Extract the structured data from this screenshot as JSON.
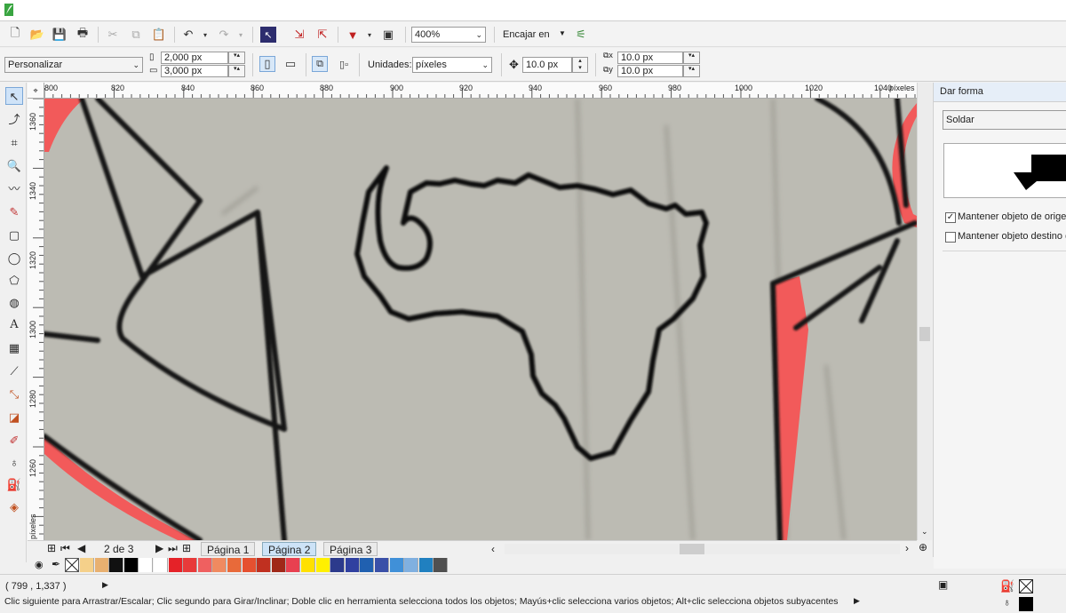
{
  "toolbar1": {
    "zoom_value": "400%",
    "snap_label": "Encajar en"
  },
  "toolbar2": {
    "preset_value": "Personalizar",
    "width_value": "2,000 px",
    "height_value": "3,000 px",
    "units_label": "Unidades:",
    "units_value": "píxeles",
    "nudge_value": "10.0 px",
    "dup_x_value": "10.0 px",
    "dup_y_value": "10.0 px"
  },
  "ruler": {
    "h_ticks": [
      "800",
      "820",
      "840",
      "860",
      "880",
      "900",
      "920",
      "940",
      "960",
      "980",
      "1000",
      "1020",
      "1040"
    ],
    "h_unit": "píxeles",
    "v_ticks": [
      "1360",
      "1340",
      "1320",
      "1300",
      "1280",
      "1260"
    ],
    "v_unit": "píxeles"
  },
  "docker": {
    "title": "Dar forma",
    "mode_value": "Soldar",
    "keep_source_label": "Mantener objeto de origen",
    "keep_source_checked": true,
    "keep_target_label": "Mantener objeto destino d",
    "keep_target_checked": false
  },
  "pages": {
    "counter": "2 de 3",
    "tabs": [
      "Página 1",
      "Página 2",
      "Página 3"
    ],
    "active_tab": "Página 2"
  },
  "palette": {
    "colors": [
      "#f5d08a",
      "#e8b070",
      "#111111",
      "#000000",
      "#ffffff",
      "#ffffff",
      "#e52228",
      "#e83a3a",
      "#ef6060",
      "#f08a60",
      "#e86a3a",
      "#e55030",
      "#c03020",
      "#a02818",
      "#e84050",
      "#ffe000",
      "#fff000",
      "#2c3a8c",
      "#3040a0",
      "#2060b0",
      "#3a50a8",
      "#4090d8",
      "#80b0e0",
      "#2080c0",
      "#505050"
    ]
  },
  "status": {
    "coords": "( 799 , 1,337 )",
    "hint": "Clic siguiente para Arrastrar/Escalar; Clic segundo para Girar/Inclinar; Doble clic en herramienta selecciona todos los objetos; Mayús+clic selecciona varios objetos; Alt+clic selecciona objetos subyacentes"
  }
}
